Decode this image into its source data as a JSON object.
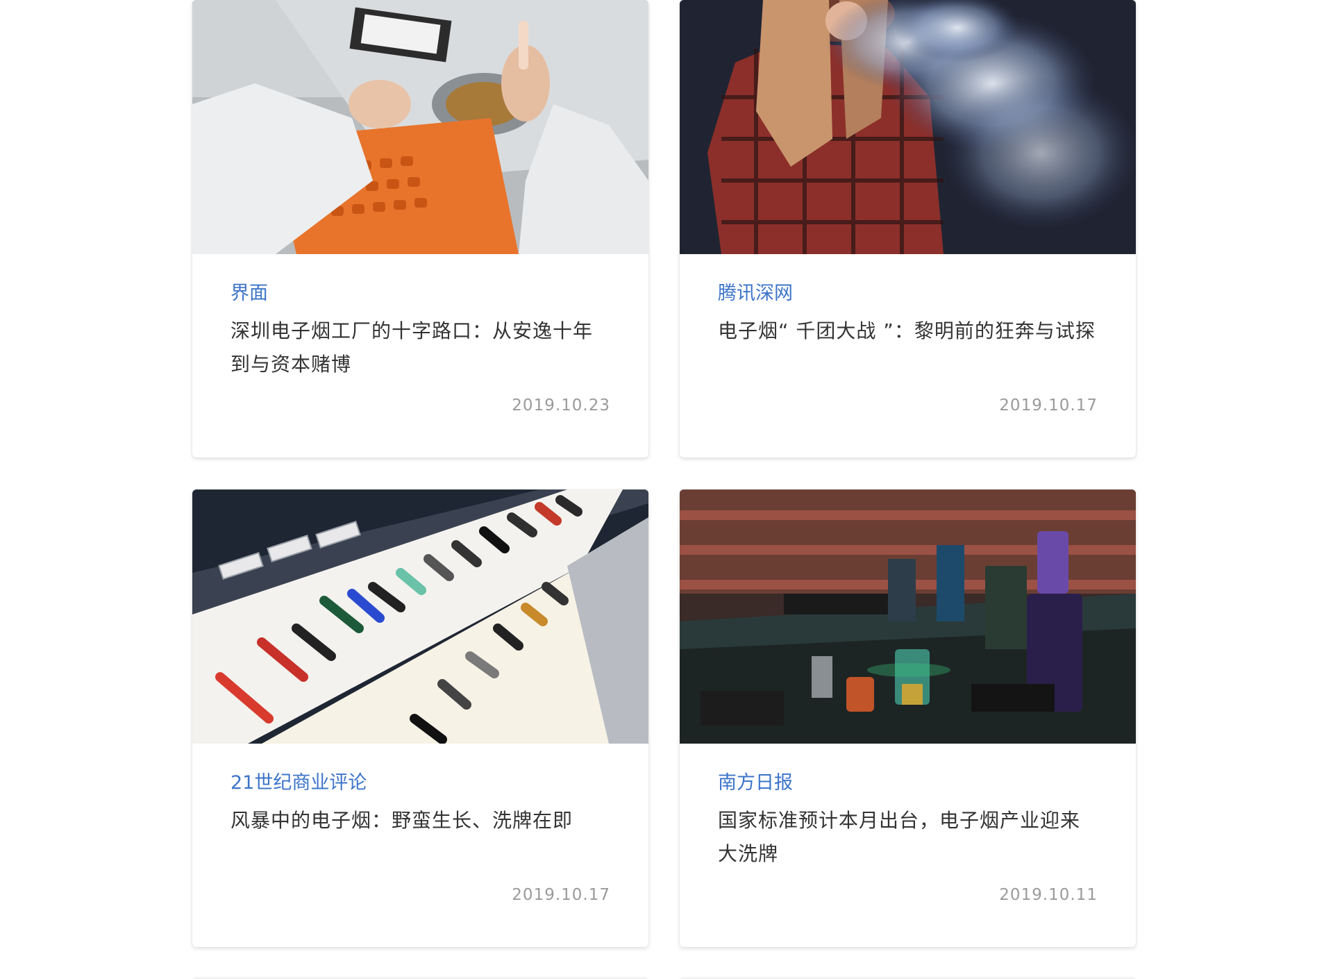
{
  "articles": [
    {
      "source": "界面",
      "title": "深圳电子烟工厂的十字路口：从安逸十年到与资本赌博",
      "date": "2019.10.23",
      "image": "lab-worker-vape-cartridge-photo"
    },
    {
      "source": "腾讯深网",
      "title": "电子烟“ 千团大战 ”：黎明前的狂奔与试探",
      "date": "2019.10.17",
      "image": "woman-exhaling-vapor-photo"
    },
    {
      "source": "21世纪商业评论",
      "title": "风暴中的电子烟：野蛮生长、洗牌在即",
      "date": "2019.10.17",
      "image": "vape-pens-display-shelf-photo"
    },
    {
      "source": "南方日报",
      "title": "国家标准预计本月出台，电子烟产业迎来大洗牌",
      "date": "2019.10.11",
      "image": "vape-shop-counter-photo"
    }
  ],
  "colors": {
    "source_link": "#3d74c9",
    "title_text": "#333333",
    "date_text": "#9a9a9a"
  }
}
